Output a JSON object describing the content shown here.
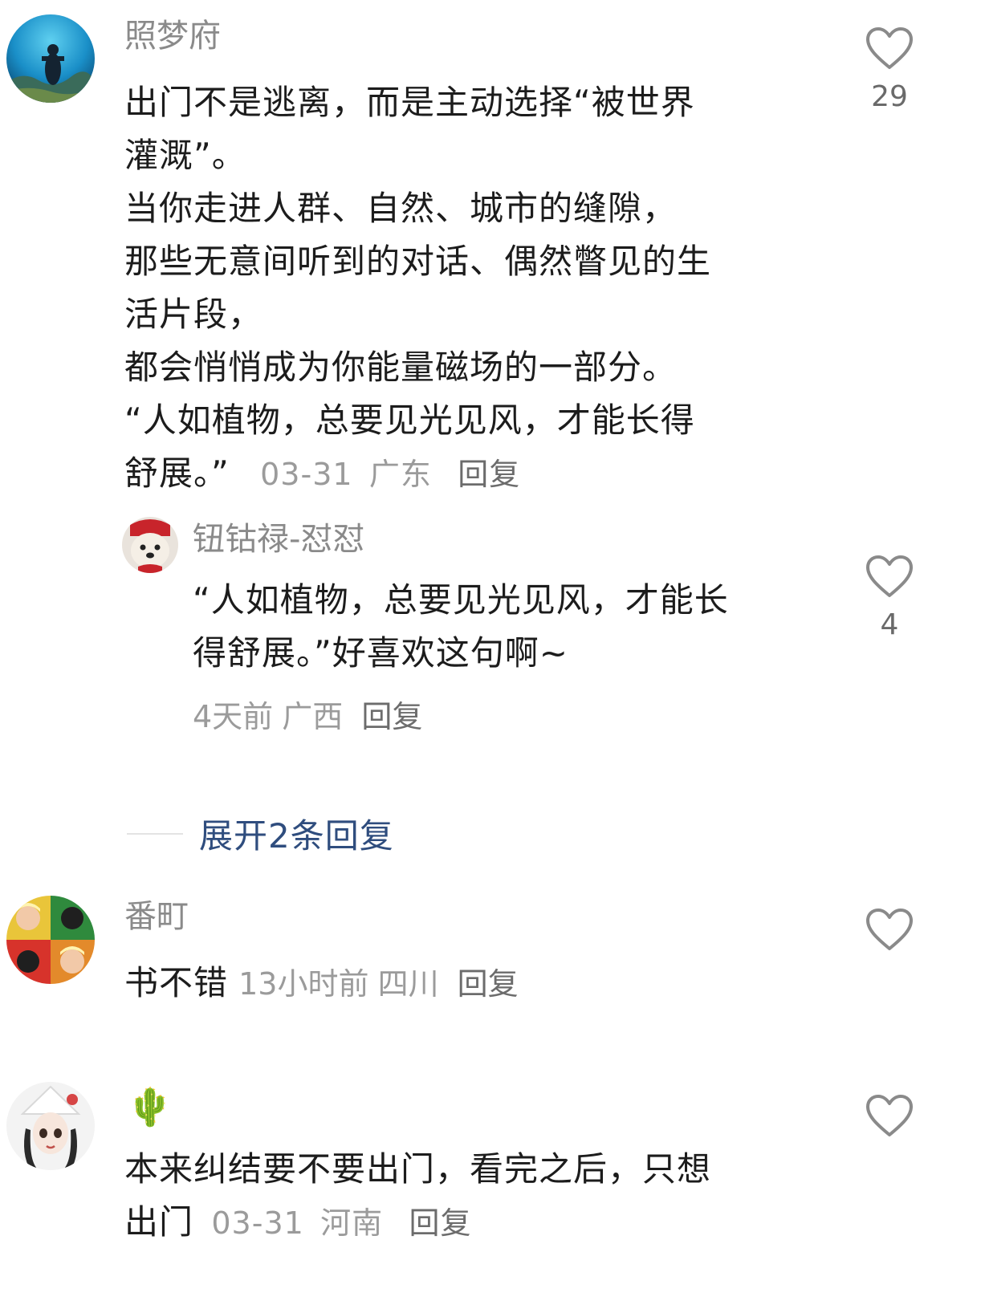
{
  "comments": [
    {
      "username": "照梦府",
      "lines": [
        "出门不是逃离，而是主动选择“被世界",
        "灌溉”。",
        "当你走进人群、自然、城市的缝隙，",
        "那些无意间听到的对话、偶然瞥见的生",
        "活片段，",
        "都会悄悄成为你能量磁场的一部分。",
        "“人如植物，总要见光见风，才能长得"
      ],
      "last_line": "舒展。”",
      "time": "03-31",
      "location": "广东",
      "reply_label": "回复",
      "likes": "29",
      "avatar_icon": "diver-photo-avatar",
      "replies": [
        {
          "username": "钮钴禄-怼怼",
          "lines": [
            "“人如植物，总要见光见风，才能长"
          ],
          "last_line": "得舒展。”好喜欢这句啊~",
          "time": "4天前",
          "location": "广西",
          "reply_label": "回复",
          "likes": "4",
          "avatar_icon": "dog-photo-avatar"
        }
      ],
      "expand_label": "展开2条回复"
    },
    {
      "username": "番町",
      "text": "书不错",
      "time": "13小时前",
      "location": "四川",
      "reply_label": "回复",
      "likes": "",
      "avatar_icon": "pop-art-avatar"
    },
    {
      "username": "🌵",
      "lines": [
        "本来纠结要不要出门，看完之后，只想"
      ],
      "last_line": "出门",
      "time": "03-31",
      "location": "河南",
      "reply_label": "回复",
      "likes": "",
      "avatar_icon": "girl-illustration-avatar"
    }
  ],
  "colors": {
    "username": "#8a8a8a",
    "body": "#1c1c1c",
    "meta": "#9b9b9b",
    "expand": "#2f4d7e"
  }
}
